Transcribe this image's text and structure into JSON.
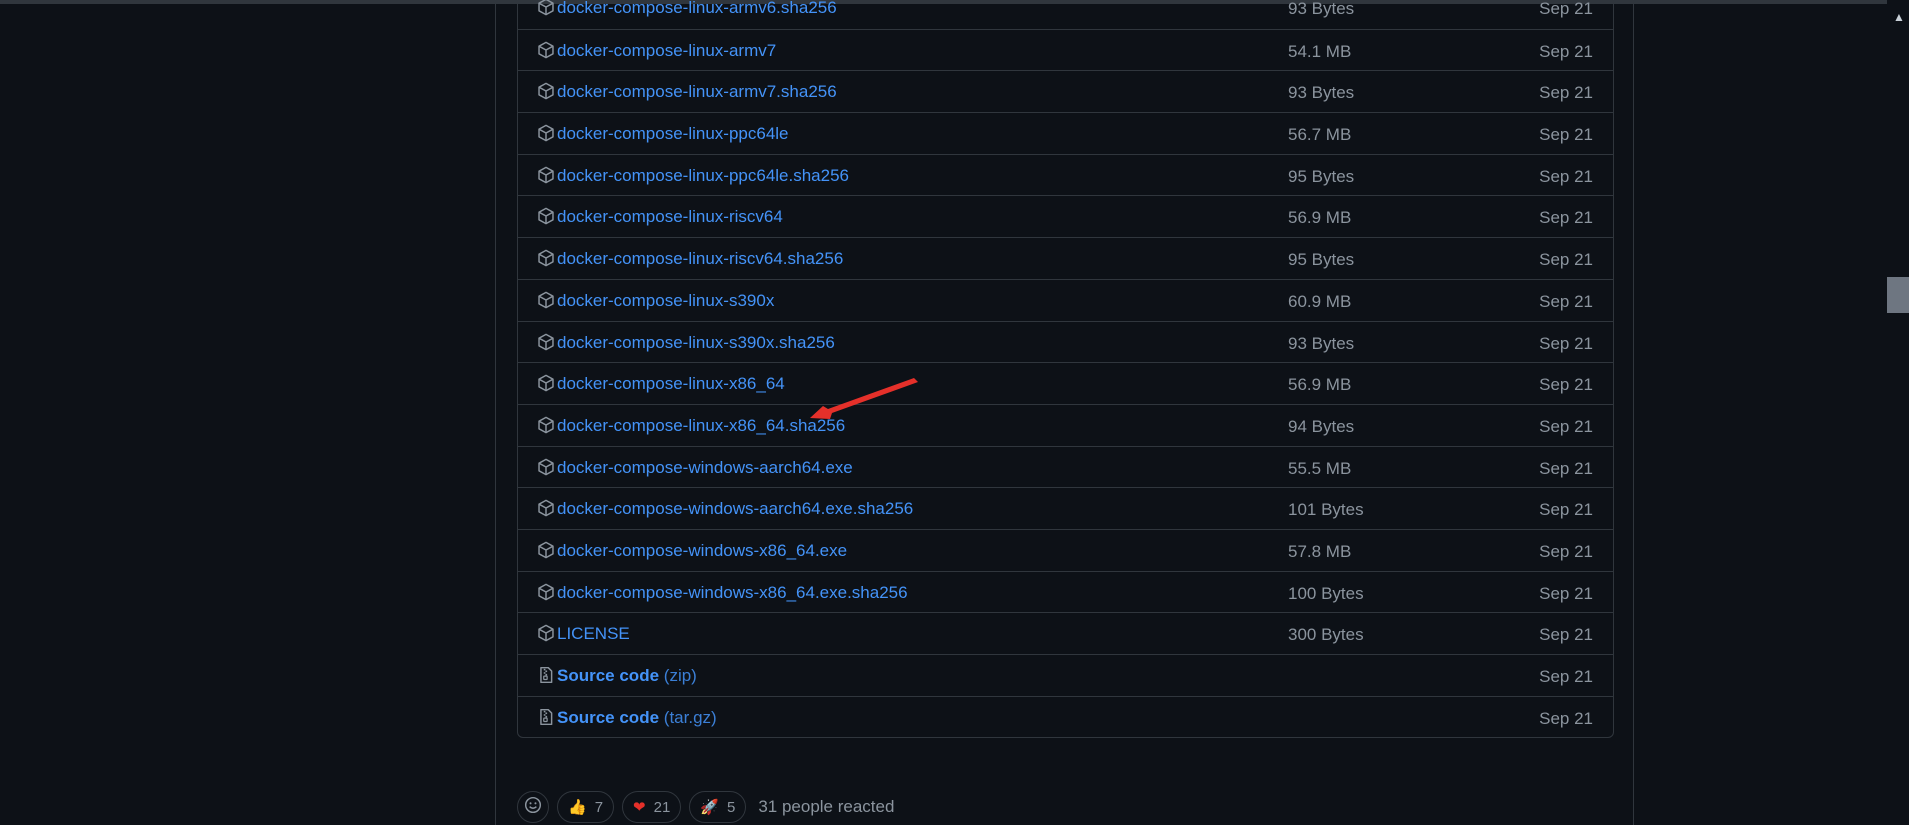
{
  "assets": [
    {
      "icon": "package-icon",
      "name": "docker-compose-linux-armv6.sha256",
      "size": "93 Bytes",
      "date": "Sep 21"
    },
    {
      "icon": "package-icon",
      "name": "docker-compose-linux-armv7",
      "size": "54.1 MB",
      "date": "Sep 21"
    },
    {
      "icon": "package-icon",
      "name": "docker-compose-linux-armv7.sha256",
      "size": "93 Bytes",
      "date": "Sep 21"
    },
    {
      "icon": "package-icon",
      "name": "docker-compose-linux-ppc64le",
      "size": "56.7 MB",
      "date": "Sep 21"
    },
    {
      "icon": "package-icon",
      "name": "docker-compose-linux-ppc64le.sha256",
      "size": "95 Bytes",
      "date": "Sep 21"
    },
    {
      "icon": "package-icon",
      "name": "docker-compose-linux-riscv64",
      "size": "56.9 MB",
      "date": "Sep 21"
    },
    {
      "icon": "package-icon",
      "name": "docker-compose-linux-riscv64.sha256",
      "size": "95 Bytes",
      "date": "Sep 21"
    },
    {
      "icon": "package-icon",
      "name": "docker-compose-linux-s390x",
      "size": "60.9 MB",
      "date": "Sep 21"
    },
    {
      "icon": "package-icon",
      "name": "docker-compose-linux-s390x.sha256",
      "size": "93 Bytes",
      "date": "Sep 21"
    },
    {
      "icon": "package-icon",
      "name": "docker-compose-linux-x86_64",
      "size": "56.9 MB",
      "date": "Sep 21"
    },
    {
      "icon": "package-icon",
      "name": "docker-compose-linux-x86_64.sha256",
      "size": "94 Bytes",
      "date": "Sep 21"
    },
    {
      "icon": "package-icon",
      "name": "docker-compose-windows-aarch64.exe",
      "size": "55.5 MB",
      "date": "Sep 21"
    },
    {
      "icon": "package-icon",
      "name": "docker-compose-windows-aarch64.exe.sha256",
      "size": "101 Bytes",
      "date": "Sep 21"
    },
    {
      "icon": "package-icon",
      "name": "docker-compose-windows-x86_64.exe",
      "size": "57.8 MB",
      "date": "Sep 21"
    },
    {
      "icon": "package-icon",
      "name": "docker-compose-windows-x86_64.exe.sha256",
      "size": "100 Bytes",
      "date": "Sep 21"
    },
    {
      "icon": "package-icon",
      "name": "LICENSE",
      "size": "300 Bytes",
      "date": "Sep 21"
    },
    {
      "icon": "file-zip-icon",
      "name": "Source code",
      "type": "(zip)",
      "size": "",
      "date": "Sep 21"
    },
    {
      "icon": "file-zip-icon",
      "name": "Source code",
      "type": "(tar.gz)",
      "size": "",
      "date": "Sep 21"
    }
  ],
  "reactions": {
    "add_reaction_icon": "smiley-icon",
    "items": [
      {
        "emoji": "👍",
        "icon": "thumbs-up-icon",
        "count": "7"
      },
      {
        "emoji": "❤",
        "icon": "heart-icon",
        "count": "21"
      },
      {
        "emoji": "🚀",
        "icon": "rocket-icon",
        "count": "5"
      }
    ],
    "summary": "31 people reacted"
  },
  "colors": {
    "background": "#0d1117",
    "border": "#30363d",
    "link": "#4493f8",
    "muted": "#8b949e",
    "arrow": "#e5302a"
  }
}
